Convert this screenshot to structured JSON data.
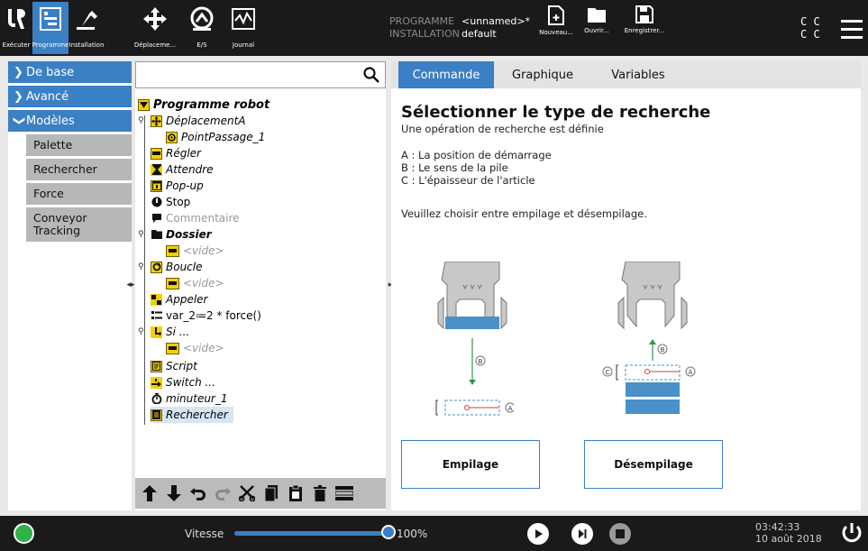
{
  "topbar": {
    "tabs": [
      {
        "label": "Exécuter",
        "icon": "ur-logo-icon"
      },
      {
        "label": "Programme",
        "icon": "program-icon"
      },
      {
        "label": "Installation",
        "icon": "robot-arm-icon"
      },
      {
        "label": "Déplaceme...",
        "icon": "move-icon"
      },
      {
        "label": "E/S",
        "icon": "io-icon"
      },
      {
        "label": "Journal",
        "icon": "log-icon"
      }
    ],
    "program_key": "PROGRAMME",
    "program_value": "<unnamed>*",
    "installation_key": "INSTALLATION",
    "installation_value": "default",
    "file_buttons": [
      {
        "label": "Nouveau...",
        "icon": "new-file-icon"
      },
      {
        "label": "Ouvrir...",
        "icon": "folder-icon"
      },
      {
        "label": "Enregistrer...",
        "icon": "save-icon"
      }
    ],
    "cc_line1": "C C",
    "cc_line2": "C C",
    "accent": "#3b7fc4"
  },
  "leftnav": {
    "sections": [
      {
        "label": "De base",
        "expanded": false
      },
      {
        "label": "Avancé",
        "expanded": false
      },
      {
        "label": "Modèles",
        "expanded": true
      }
    ],
    "sub_items": [
      "Palette",
      "Rechercher",
      "Force",
      "Conveyor Tracking"
    ]
  },
  "tree": {
    "search_placeholder": "",
    "nodes": [
      {
        "label": "Programme robot",
        "icon": "program-root-icon"
      },
      {
        "label": "DéplacementA",
        "icon": "move-icon"
      },
      {
        "label": "PointPassage_1",
        "icon": "waypoint-icon"
      },
      {
        "label": "Régler",
        "icon": "set-icon"
      },
      {
        "label": "Attendre",
        "icon": "wait-icon"
      },
      {
        "label": "Pop-up",
        "icon": "popup-icon"
      },
      {
        "label": "Stop",
        "icon": "stop-icon"
      },
      {
        "label": "Commentaire",
        "icon": "comment-icon"
      },
      {
        "label": "Dossier",
        "icon": "folder-icon"
      },
      {
        "label": "<vide>",
        "icon": "empty-icon"
      },
      {
        "label": "Boucle",
        "icon": "loop-icon"
      },
      {
        "label": "<vide>",
        "icon": "empty-icon"
      },
      {
        "label": "Appeler",
        "icon": "call-icon"
      },
      {
        "label": "var_2≔2 * force()",
        "icon": "assignment-icon"
      },
      {
        "label": "Si ...",
        "icon": "if-icon"
      },
      {
        "label": "<vide>",
        "icon": "empty-icon"
      },
      {
        "label": "Script",
        "icon": "script-icon"
      },
      {
        "label": "Switch ...",
        "icon": "switch-icon"
      },
      {
        "label": "minuteur_1",
        "icon": "timer-icon"
      },
      {
        "label": "Rechercher",
        "icon": "search-node-icon"
      }
    ],
    "toolbar": [
      "move-up-icon",
      "move-down-icon",
      "undo-icon",
      "redo-icon",
      "cut-icon",
      "copy-icon",
      "paste-icon",
      "delete-icon",
      "suppress-icon"
    ]
  },
  "right": {
    "tabs": [
      "Commande",
      "Graphique",
      "Variables"
    ],
    "title": "Sélectionner le type de recherche",
    "subtitle": "Une opération de recherche est définie",
    "line_a": "A : La position de démarrage",
    "line_b": "B : Le sens de la pile",
    "line_c": "C : L'épaisseur de l'article",
    "instruction": "Veuillez choisir entre empilage et désempilage.",
    "diagram_labels": {
      "a": "A",
      "b": "B",
      "c": "C"
    },
    "btn_stack": "Empilage",
    "btn_unstack": "Désempilage"
  },
  "bottombar": {
    "speed_label": "Vitesse",
    "speed_value": "100%",
    "speed_fraction": 1.0,
    "time": "03:42:33",
    "date": "10 août 2018",
    "status_color": "#2fb24a"
  }
}
